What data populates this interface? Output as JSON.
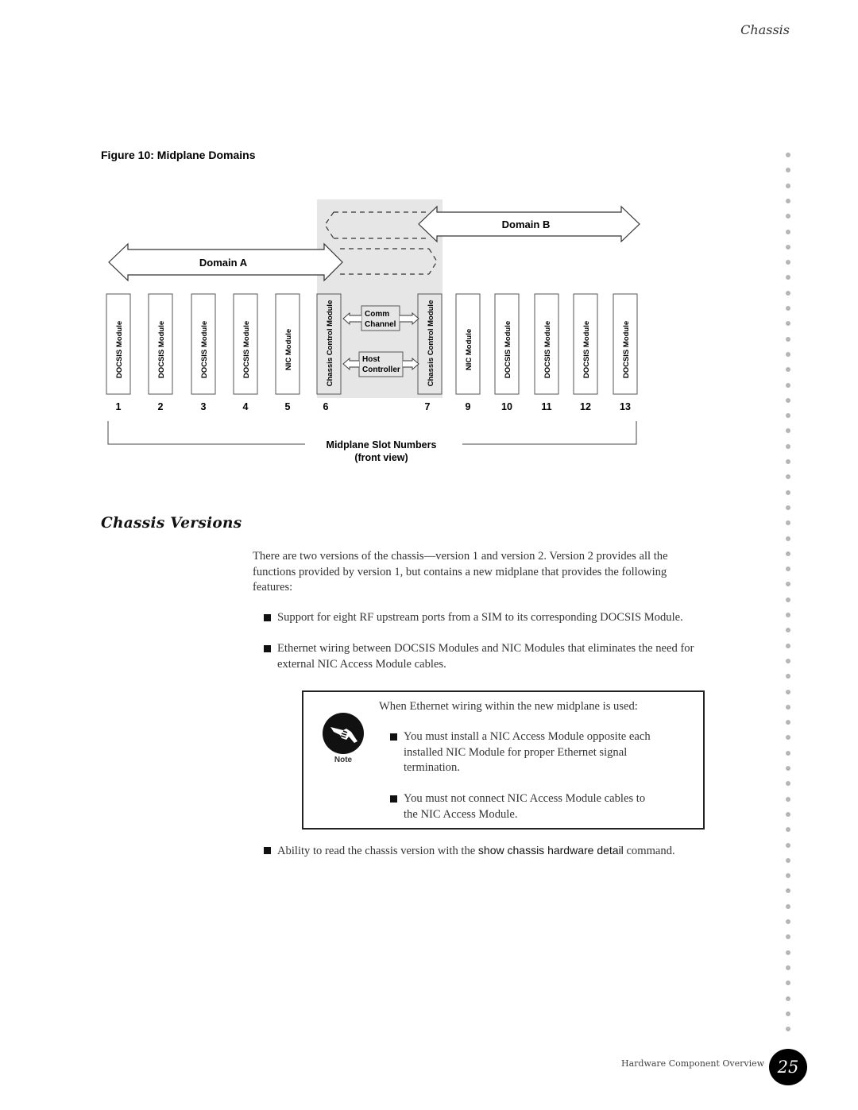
{
  "running_head": "Chassis",
  "figure": {
    "caption": "Figure 10:  Midplane Domains",
    "domain_a": "Domain A",
    "domain_b": "Domain B",
    "slots": [
      {
        "number": "1",
        "module": "DOCSIS Module"
      },
      {
        "number": "2",
        "module": "DOCSIS Module"
      },
      {
        "number": "3",
        "module": "DOCSIS Module"
      },
      {
        "number": "4",
        "module": "DOCSIS Module"
      },
      {
        "number": "5",
        "module": "NIC Module"
      },
      {
        "number": "6",
        "module": "Chassis Control Module"
      },
      {
        "number": "7",
        "module": "Chassis Control Module"
      },
      {
        "number": "9",
        "module": "NIC Module"
      },
      {
        "number": "10",
        "module": "DOCSIS Module"
      },
      {
        "number": "11",
        "module": "DOCSIS Module"
      },
      {
        "number": "12",
        "module": "DOCSIS Module"
      },
      {
        "number": "13",
        "module": "DOCSIS Module"
      }
    ],
    "comm_channel": [
      "Comm",
      "Channel"
    ],
    "host_controller": [
      "Host",
      "Controller"
    ],
    "axis_label": [
      "Midplane Slot Numbers",
      "(front view)"
    ]
  },
  "section": {
    "title": "Chassis Versions",
    "intro_lines": [
      "There are two versions of the chassis—version 1 and version 2. Version 2 provides all the",
      "functions provided by version 1, but contains a new midplane that provides the following",
      "features:"
    ],
    "bullets": [
      {
        "lines": [
          "Support for eight RF upstream ports from a SIM to its corresponding DOCSIS Module."
        ]
      },
      {
        "lines": [
          "Ethernet wiring between DOCSIS Modules and NIC Modules that eliminates the need for",
          "external NIC Access Module cables."
        ]
      }
    ],
    "note": {
      "label": "Note",
      "lead": "When Ethernet wiring within the new midplane is used:",
      "bullets": [
        {
          "lines": [
            "You must install a NIC Access Module opposite each",
            "installed NIC Module for proper Ethernet signal",
            "termination."
          ]
        },
        {
          "lines": [
            "You must not connect NIC Access Module cables to",
            "the NIC Access Module."
          ]
        }
      ]
    },
    "last_bullet": {
      "before": "Ability to read the chassis version with the ",
      "command": "show chassis hardware detail",
      "after": " command."
    }
  },
  "footer": {
    "title": "Hardware Component Overview",
    "page_number": "25"
  }
}
